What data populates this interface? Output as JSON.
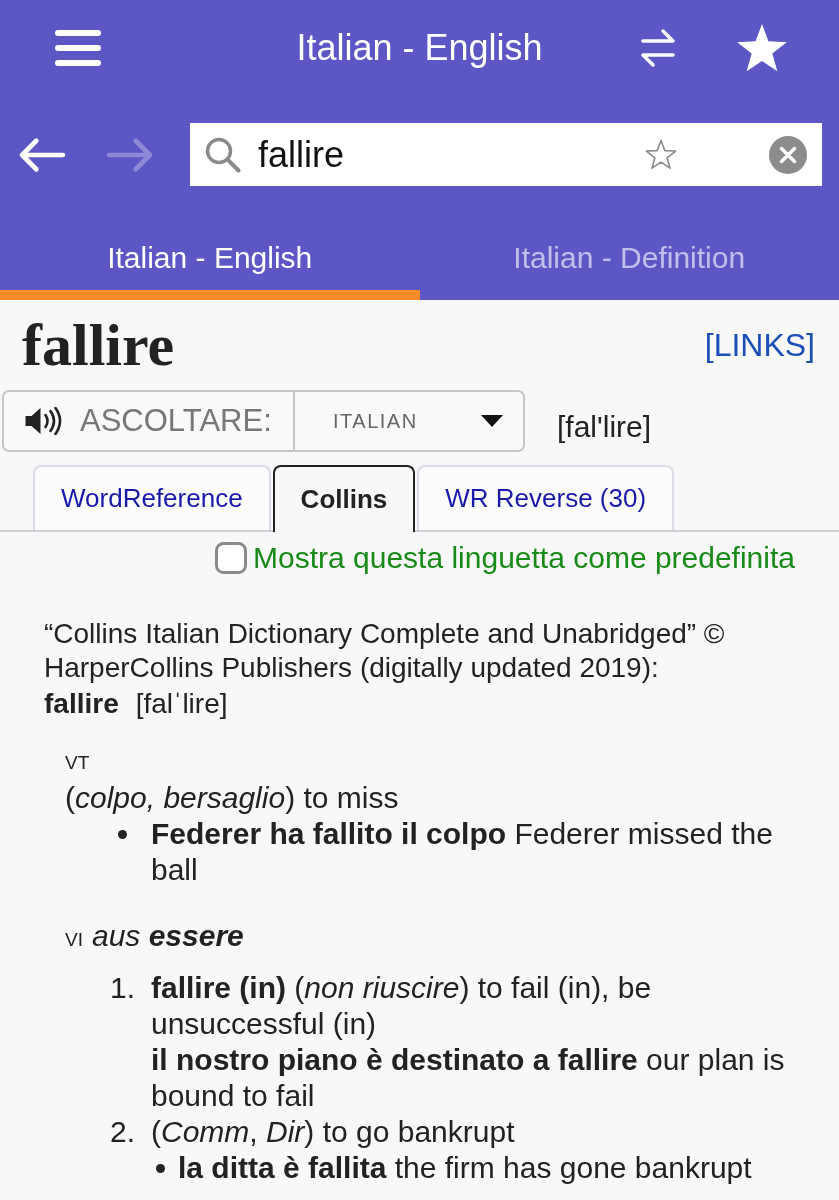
{
  "app_bar": {
    "title": "Italian - English"
  },
  "navigation": [
    {
      "kind": "back",
      "disabled": false
    },
    {
      "kind": "forward",
      "disabled": true
    }
  ],
  "search": {
    "value": "fallire",
    "starred": false
  },
  "dictionary_tabs": [
    {
      "label": "Italian - English",
      "selected": true
    },
    {
      "label": "Italian - Definition",
      "selected": false
    }
  ],
  "entry": {
    "headword": "fallire",
    "links": "[LINKS]"
  },
  "audio": {
    "label": "ASCOLTARE:",
    "language": "ITALIAN",
    "pronunciation": "[fal'lire]"
  },
  "source_tabs": [
    {
      "label": "WordReference",
      "selected": false
    },
    {
      "label": "Collins",
      "selected": true
    },
    {
      "label": "WR Reverse (30)",
      "selected": false
    }
  ],
  "default_tab": {
    "label": "Mostra questa linguetta come predefinita",
    "checked": false
  },
  "definition": {
    "source": "“Collins Italian Dictionary Complete and Unabridged” © HarperCollins Publishers (digitally updated 2019):",
    "headword": "fallire",
    "pronunciation": "[falˈlire]",
    "sections": [
      {
        "pos": "VT",
        "senses": [
          {
            "text": "(*colpo, bersaglio*) to miss",
            "examples": [
              {
                "kind": "bullet",
                "text": "**Federer ha fallito il colpo** Federer missed the ball"
              }
            ]
          }
        ]
      },
      {
        "pos": "VI",
        "grammar": "aus **essere**",
        "senses": [
          {
            "number": "1.",
            "text": "**fallire (in)** (*non riuscire*) to fail (in), be unsuccessful (in)",
            "examples": [
              {
                "kind": "plain",
                "text": "**il nostro piano è destinato a fallire** our plan is bound to fail"
              }
            ]
          },
          {
            "number": "2.",
            "text": "(*Comm*, *Dir*) to go bankrupt",
            "examples": [
              {
                "kind": "bullet",
                "text": "**la ditta è fallita** the firm has gone bankrupt"
              }
            ]
          }
        ]
      }
    ]
  }
}
